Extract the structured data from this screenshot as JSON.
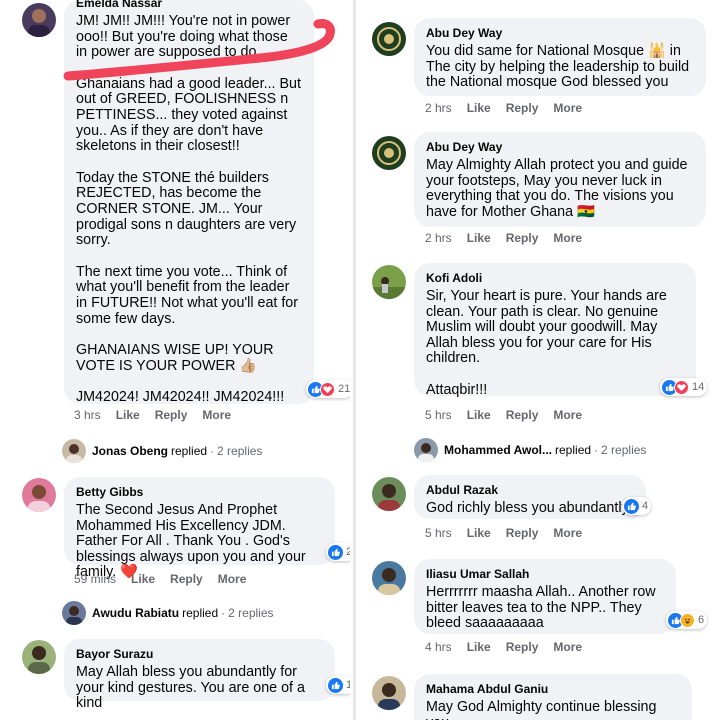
{
  "left": {
    "c1": {
      "author": "Emelda Nassar",
      "p1": "JM! JM!! JM!!! You're not in power ooo!! But you're doing what those in power are supposed to do.",
      "p2": "Ghanaians had a good leader... But out of GREED, FOOLISHNESS n PETTINESS... they voted against you.. As if they are don't have skeletons in their closest!!",
      "p3": "Today the STONE thé builders REJECTED, has become the CORNER STONE. JM... Your prodigal sons n daughters are very sorry.",
      "p4": "The next time you vote... Think of what you'll benefit from the leader in FUTURE!! Not what you'll eat for some few days.",
      "p5": "GHANAIANS WISE UP! YOUR VOTE IS YOUR POWER 👍🏼",
      "p6": "JM42024! JM42024!! JM42024!!!",
      "reactions": "21",
      "time": "3 hrs",
      "like": "Like",
      "reply": "Reply",
      "more": "More"
    },
    "r1": {
      "name": "Jonas Obeng",
      "replied": "replied",
      "count": "2 replies"
    },
    "c2": {
      "author": "Betty Gibbs",
      "text": "The Second Jesus And Prophet Mohammed His Excellency JDM. Father For All . Thank You . God's blessings always upon you and your family. ❤️",
      "reactions": "2",
      "time": "59 mins",
      "like": "Like",
      "reply": "Reply",
      "more": "More"
    },
    "r2": {
      "name": "Awudu Rabiatu",
      "replied": "replied",
      "count": "2 replies"
    },
    "c3": {
      "author": "Bayor Surazu",
      "text": "May Allah bless you abundantly for your kind gestures. You are one of a kind",
      "reactions": "1"
    }
  },
  "right": {
    "c1": {
      "author": "Abu Dey Way",
      "text": "You did same for National Mosque 🕌 in The city by helping the leadership to build the National mosque God blessed you",
      "time": "2 hrs",
      "like": "Like",
      "reply": "Reply",
      "more": "More"
    },
    "c2": {
      "author": "Abu Dey Way",
      "text": "May Almighty Allah protect you and guide your footsteps, May you never luck in everything that you do. The visions you have for Mother Ghana 🇬🇭",
      "time": "2 hrs",
      "like": "Like",
      "reply": "Reply",
      "more": "More"
    },
    "c3": {
      "author": "Kofi Adoli",
      "p1": "Sir, Your heart is pure. Your hands are clean. Your path is clear. No genuine Muslim will doubt your goodwill. May Allah bless you for your care for His children.",
      "p2": "Attaqbir!!!",
      "reactions": "14",
      "time": "5 hrs",
      "like": "Like",
      "reply": "Reply",
      "more": "More"
    },
    "r1": {
      "name": "Mohammed Awol...",
      "replied": "replied",
      "count": "2 replies"
    },
    "c4": {
      "author": "Abdul Razak",
      "text": "God richly bless you abundantly",
      "reactions": "4",
      "time": "5 hrs",
      "like": "Like",
      "reply": "Reply",
      "more": "More"
    },
    "c5": {
      "author": "Iliasu Umar Sallah",
      "text": "Herrrrrrr maasha Allah.. Another row bitter leaves tea to the NPP.. They bleed saaaaaaaaa",
      "reactions": "6",
      "time": "4 hrs",
      "like": "Like",
      "reply": "Reply",
      "more": "More"
    },
    "c6": {
      "author": "Mahama Abdul Ganiu",
      "text": "May God Almighty continue blessing you"
    }
  }
}
